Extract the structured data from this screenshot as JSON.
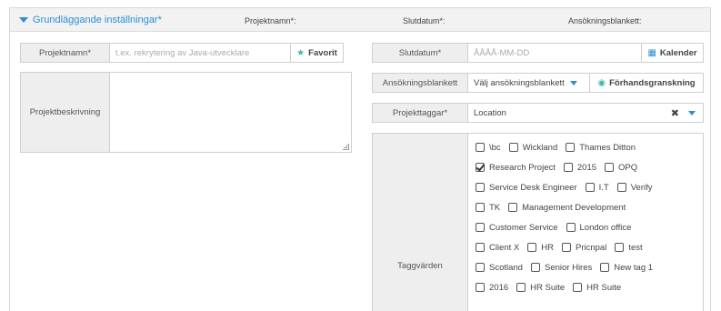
{
  "header": {
    "toggle_label": "Grundläggande inställningar*",
    "summary_project": "Projektnamn*:",
    "summary_enddate": "Slutdatum*:",
    "summary_form": "Ansökningsblankett:"
  },
  "project_name": {
    "label": "Projektnamn*",
    "placeholder": "t.ex. rekrytering av Java-utvecklare",
    "favorite_label": "Favorit",
    "favorite_icon": "star-folder-icon"
  },
  "description": {
    "label": "Projektbeskrivning",
    "value": ""
  },
  "end_date": {
    "label": "Slutdatum*",
    "placeholder": "ÅÅÅÅ-MM-DD",
    "calendar_label": "Kalender",
    "calendar_icon": "calendar-icon"
  },
  "application_form": {
    "label": "Ansökningsblankett",
    "selected": "Välj ansökningsblankett",
    "preview_label": "Förhandsgranskning",
    "preview_icon": "eye-icon"
  },
  "project_tags": {
    "label": "Projekttaggar*",
    "selected": "Location",
    "clear_icon": "close-icon"
  },
  "tag_values": {
    "label": "Taggvärden",
    "rows": [
      [
        {
          "label": "\\bc",
          "checked": false
        },
        {
          "label": "Wickland",
          "checked": false
        },
        {
          "label": "Thames Ditton",
          "checked": false
        }
      ],
      [
        {
          "label": "Research Project",
          "checked": true
        },
        {
          "label": "2015",
          "checked": false
        },
        {
          "label": "OPQ",
          "checked": false
        }
      ],
      [
        {
          "label": "Service Desk Engineer",
          "checked": false
        },
        {
          "label": "I.T",
          "checked": false
        },
        {
          "label": "Verify",
          "checked": false
        }
      ],
      [
        {
          "label": "TK",
          "checked": false
        },
        {
          "label": "Management Development",
          "checked": false
        }
      ],
      [
        {
          "label": "Customer Service",
          "checked": false
        },
        {
          "label": "London office",
          "checked": false
        }
      ],
      [
        {
          "label": "Client X",
          "checked": false
        },
        {
          "label": "HR",
          "checked": false
        },
        {
          "label": "Pricnpal",
          "checked": false
        },
        {
          "label": "test",
          "checked": false
        }
      ],
      [
        {
          "label": "Scotland",
          "checked": false
        },
        {
          "label": "Senior Hires",
          "checked": false
        },
        {
          "label": "New tag 1",
          "checked": false
        }
      ],
      [
        {
          "label": "2016",
          "checked": false
        },
        {
          "label": "HR Suite",
          "checked": false
        },
        {
          "label": "HR Suite",
          "checked": false
        }
      ]
    ]
  },
  "colors": {
    "accent": "#2a8fd4",
    "teal": "#3fb8a9",
    "label_bg": "#eeeeee",
    "border": "#cfcfcf"
  }
}
